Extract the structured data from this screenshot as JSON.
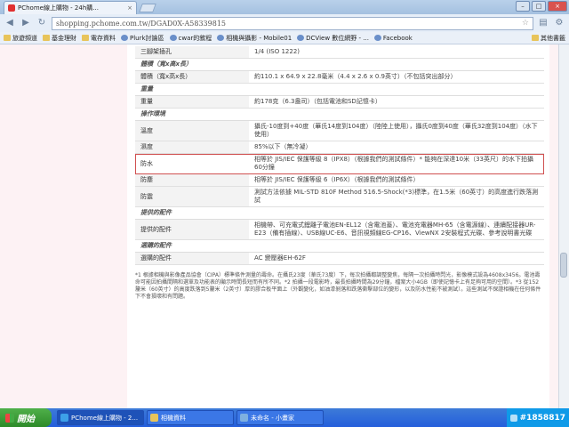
{
  "browser": {
    "tab_title": "PChome線上購物 - 24h購...",
    "tab_close": "×",
    "url": "shopping.pchome.com.tw/DGAD0X-A58339815",
    "window_buttons": [
      "–",
      "□",
      "×"
    ]
  },
  "bookmarks": [
    {
      "label": "旅遊頻道",
      "icon": "folder-icon"
    },
    {
      "label": "基金理財",
      "icon": "folder-icon"
    },
    {
      "label": "電存資料",
      "icon": "folder-icon"
    },
    {
      "label": "Plurk討論區",
      "icon": "site-icon"
    },
    {
      "label": "cwar的敘程",
      "icon": "site-icon"
    },
    {
      "label": "相機與攝影 - Mobile01",
      "icon": "site-icon"
    },
    {
      "label": "DCView 數位網野 - ...",
      "icon": "site-icon"
    },
    {
      "label": "Facebook",
      "icon": "site-icon"
    }
  ],
  "bookmarks_other": "其他書籤",
  "spec_rows": [
    {
      "type": "row",
      "label": "三腳架插孔",
      "value": "1/4 (ISO 1222)"
    },
    {
      "type": "section",
      "label": "體積（寬x高x長）"
    },
    {
      "type": "row",
      "label": "體積（寬x高x長）",
      "value": "約110.1 x 64.9 x 22.8毫米（4.4 x 2.6 x 0.9英寸）（不包括突出部分）"
    },
    {
      "type": "section",
      "label": "重量"
    },
    {
      "type": "row",
      "label": "重量",
      "value": "約178克（6.3盎司）（包括電池和SD記憶卡）"
    },
    {
      "type": "section",
      "label": "操作環境"
    },
    {
      "type": "row",
      "label": "溫度",
      "value": "攝氏-10度到+40度（華氏14度到104度）（陸陸上使用），攝氏0度到40度（華氏32度到104度）（水下使用）"
    },
    {
      "type": "row",
      "label": "濕度",
      "value": "85%以下（無冷凝）"
    },
    {
      "type": "highlight",
      "label": "防水",
      "value": "相等於 JIS/IEC 保護等級 8（IPX8）（根據我們的測試條件）* 能夠在深達10米（33英尺）的水下拍攝60分鐘"
    },
    {
      "type": "row",
      "label": "防塵",
      "value": "相等於 JIS/IEC 保護等級 6（IP6X）（根據我們的測試條件）"
    },
    {
      "type": "row",
      "label": "防震",
      "value": "測試方法依據 MIL-STD 810F Method 516.5-Shock(*3)標準，在1.5米（60英寸）的高度進行跌落測試"
    },
    {
      "type": "section",
      "label": "提供的配件"
    },
    {
      "type": "row",
      "label": "提供的配件",
      "value": "相機帶、可充電式鋰離子電池EN-EL12（含電池蓋）、電池充電器MH-65（含電源線）、連續配接器UR-E23（備有插線）、USB線UC-E6、音訊視頻線EG-CP16、ViewNX 2安裝程式光碟、參考說明書光碟"
    },
    {
      "type": "section",
      "label": "選購的配件"
    },
    {
      "type": "row",
      "label": "選購的配件",
      "value": "AC 變壓器EH-62F"
    }
  ],
  "footnote": "*1 根據相機與影像產品協會（CIPA）標準條件測量的壽命。在攝氏23度（華氏73度）下，每次拍攝都調整變焦，每隔一次拍攝時閃光，影像模式設為4608x3456。電池壽命可能因拍攝間隔和選單及功能表的顯示時間長短而有所不同。*2 拍攝一段電影時，最長拍攝時間為29分鐘，檔案大小4GB（即使記憶卡上有足夠可用的空間）。*3 從152釐米（60英寸）的高度跌落到5釐米（2英寸）厚的膠合板平面上（外觀變化，如油漆剝落和跌落衝擊部位的變形，以及防水性能不被測試）。這些測試不保證相機在任何條件下不會損壞和有問題。",
  "taskbar": {
    "start_label": "開始",
    "items": [
      {
        "label": "PChome線上購物 - 2...",
        "active": true
      },
      {
        "label": "相機資料",
        "active": false
      },
      {
        "label": "未命名 - 小畫家",
        "active": false
      }
    ],
    "tray_text": "#1858817"
  }
}
